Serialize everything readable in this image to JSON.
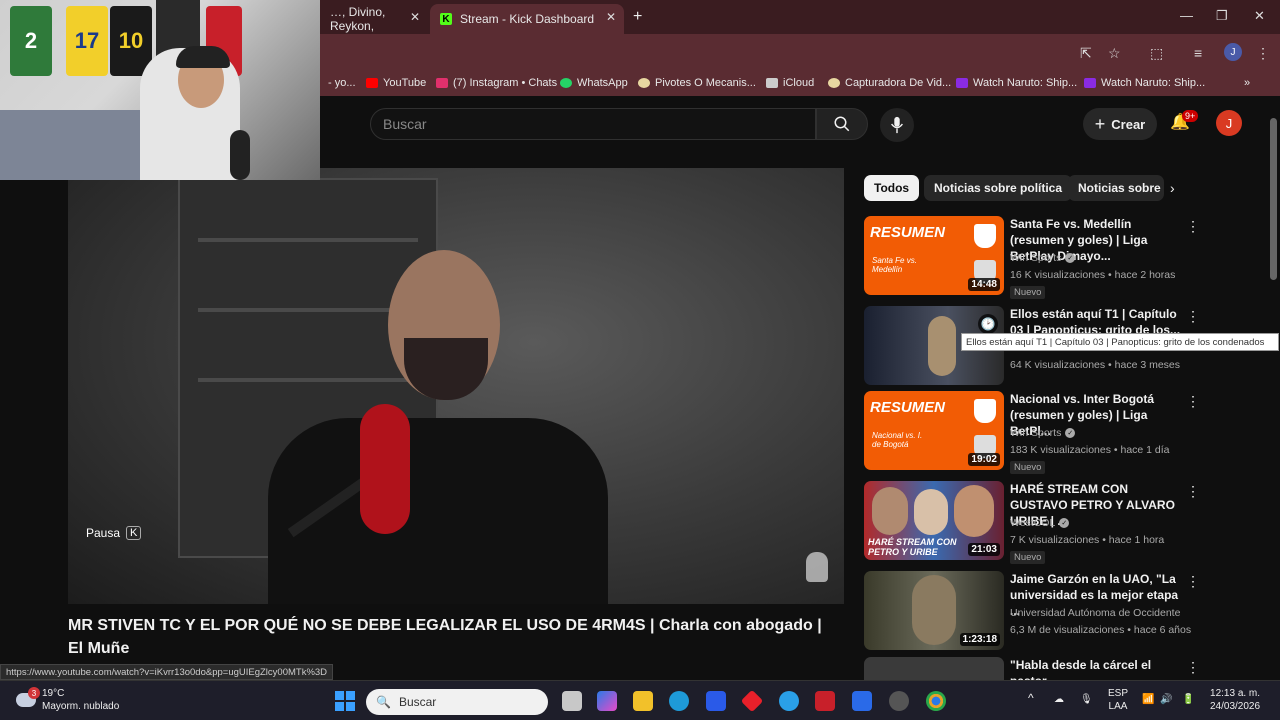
{
  "browser": {
    "tabs": [
      {
        "label": "…, Divino, Reykon,"
      },
      {
        "label": "Stream - Kick Dashboard"
      }
    ],
    "bookmarks": [
      {
        "label": "- yo...",
        "color": "#aaaaaa"
      },
      {
        "label": "YouTube",
        "color": "#ff0000"
      },
      {
        "label": "(7) Instagram • Chats",
        "color": "#e1306c"
      },
      {
        "label": "WhatsApp",
        "color": "#25d366"
      },
      {
        "label": "Pivotes O Mecanis...",
        "color": "#e8d7a0"
      },
      {
        "label": "iCloud",
        "color": "#cccccc"
      },
      {
        "label": "Capturadora De Vid...",
        "color": "#e8d7a0"
      },
      {
        "label": "Watch Naruto: Ship...",
        "color": "#8a2be2"
      },
      {
        "label": "Watch Naruto: Ship...",
        "color": "#8a2be2"
      }
    ],
    "profile_initial": "J",
    "status_url": "https://www.youtube.com/watch?v=iKvrr13o0do&pp=ugUIEgZlcy00MTk%3D"
  },
  "youtube": {
    "search_placeholder": "Buscar",
    "create_label": "Crear",
    "notif_badge": "9+",
    "user_initial": "J",
    "player": {
      "pause_label": "Pausa",
      "pause_key": "K"
    },
    "video_title": "MR STIVEN TC Y EL POR QUÉ NO SE DEBE LEGALIZAR EL USO DE 4RM4S | Charla con abogado | El Muñe",
    "chips": [
      {
        "label": "Todos"
      },
      {
        "label": "Noticias sobre política"
      },
      {
        "label": "Noticias sobre"
      }
    ],
    "recommendations": [
      {
        "title": "Santa Fe vs. Medellín (resumen y goles) | Liga BetPlay Dimayo...",
        "channel": "Win Sports",
        "meta": "16 K visualizaciones • hace 2 horas",
        "badge": "Nuevo",
        "duration": "14:48",
        "thumb_big": "RESUMEN",
        "thumb_small": "Santa Fe vs. Medellín"
      },
      {
        "title": "Ellos están aquí T1 | Capítulo 03 | Panopticus: grito de los...",
        "channel": "",
        "meta": "64 K visualizaciones • hace 3 meses",
        "badge": "",
        "duration": ""
      },
      {
        "title": "Nacional vs. Inter Bogotá (resumen y goles) | Liga BetPl...",
        "channel": "Win Sports",
        "meta": "183 K visualizaciones • hace 1 día",
        "badge": "Nuevo",
        "duration": "19:02",
        "thumb_big": "RESUMEN",
        "thumb_small": "Nacional vs. I. de Bogotá"
      },
      {
        "title": "HARÉ STREAM CON GUSTAVO PETRO Y ALVARO URIBE | ...",
        "channel": "WestCOL",
        "meta": "7 K visualizaciones • hace 1 hora",
        "badge": "Nuevo",
        "duration": "21:03",
        "thumb_big": "HARÉ STREAM CON PETRO Y URIBE"
      },
      {
        "title": "Jaime Garzón en la UAO, \"La universidad es la mejor etapa ...",
        "channel": "Universidad Autónoma de Occidente",
        "meta": "6,3 M de visualizaciones • hace 6 años",
        "badge": "",
        "duration": "1:23:18"
      },
      {
        "title": "\"Habla desde la cárcel el pastor",
        "channel": "",
        "meta": "",
        "badge": "",
        "duration": ""
      }
    ],
    "tooltip": "Ellos están aquí T1 | Capítulo 03 | Panopticus: grito de los condenados"
  },
  "webcam": {
    "jerseys": [
      "2",
      "17",
      "10",
      ""
    ]
  },
  "taskbar": {
    "weather_temp": "19°C",
    "weather_desc": "Mayorm. nublado",
    "weather_alert": "3",
    "search_placeholder": "Buscar",
    "lang_top": "ESP",
    "lang_bottom": "LAA",
    "time": "12:13 a. m.",
    "date": "24/03/2026"
  }
}
